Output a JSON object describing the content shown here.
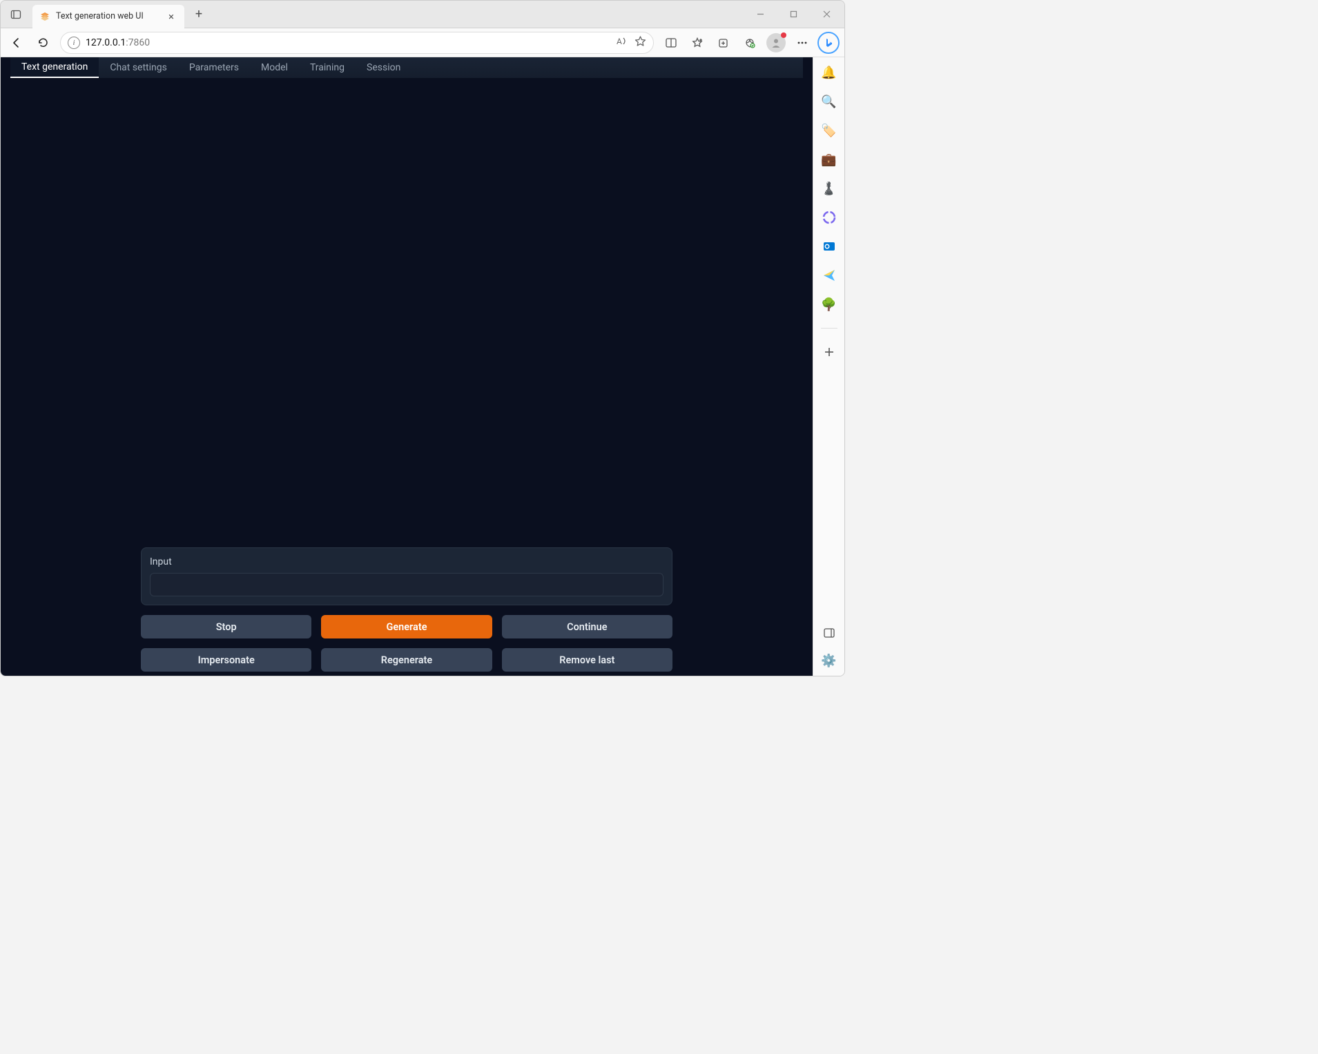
{
  "browser": {
    "tab_title": "Text generation web UI",
    "address": {
      "host": "127.0.0.1",
      "port": ":7860"
    }
  },
  "app": {
    "tabs": [
      {
        "label": "Text generation",
        "active": true
      },
      {
        "label": "Chat settings",
        "active": false
      },
      {
        "label": "Parameters",
        "active": false
      },
      {
        "label": "Model",
        "active": false
      },
      {
        "label": "Training",
        "active": false
      },
      {
        "label": "Session",
        "active": false
      }
    ],
    "input": {
      "label": "Input",
      "value": ""
    },
    "buttons": {
      "stop": "Stop",
      "generate": "Generate",
      "continue": "Continue",
      "impersonate": "Impersonate",
      "regenerate": "Regenerate",
      "remove_last": "Remove last"
    }
  },
  "sidebar_icons": [
    "notifications-icon",
    "search-icon",
    "tag-icon",
    "briefcase-icon",
    "games-icon",
    "copilot-icon",
    "outlook-icon",
    "send-icon",
    "tree-icon"
  ]
}
